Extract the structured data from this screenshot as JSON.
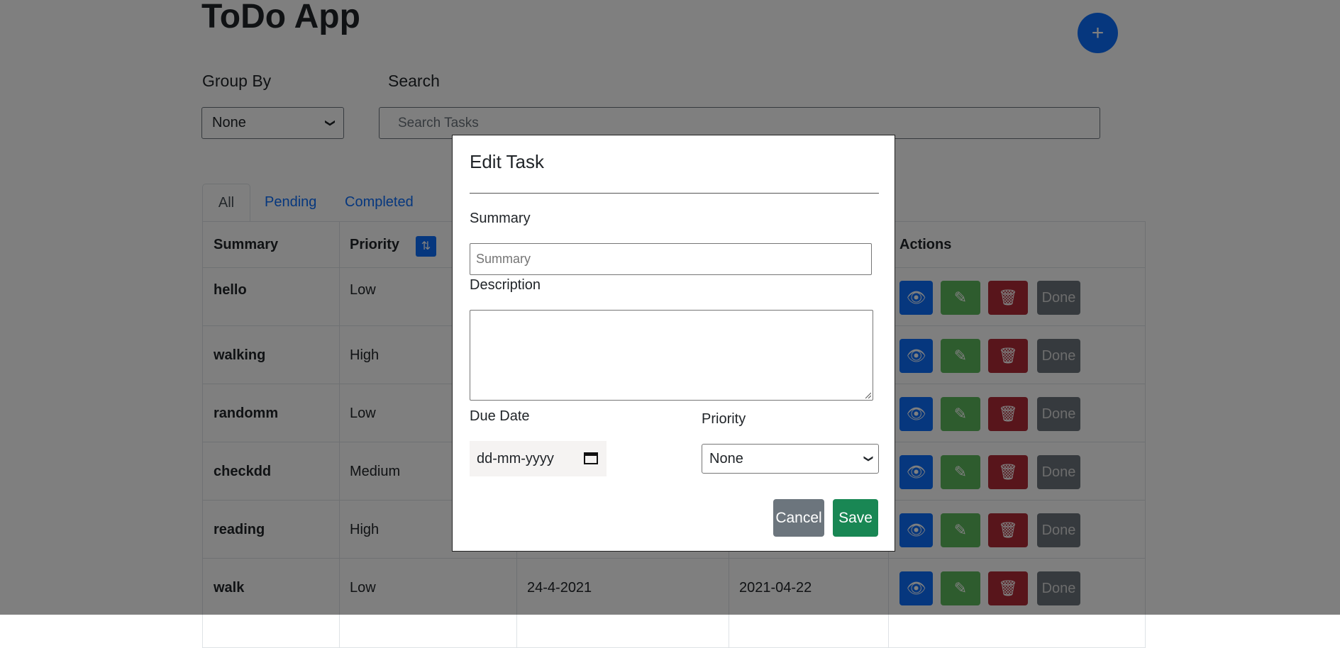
{
  "app": {
    "title": "ToDo App",
    "add_button_label": "+"
  },
  "filters": {
    "group_by_label": "Group By",
    "group_by_value": "None",
    "search_label": "Search",
    "search_placeholder": "Search Tasks"
  },
  "tabs": [
    {
      "label": "All",
      "active": true
    },
    {
      "label": "Pending",
      "active": false
    },
    {
      "label": "Completed",
      "active": false
    }
  ],
  "table": {
    "headers": {
      "summary": "Summary",
      "priority": "Priority",
      "actions": "Actions"
    },
    "rows": [
      {
        "summary": "hello",
        "priority": "Low",
        "created": "",
        "due": ""
      },
      {
        "summary": "walking",
        "priority": "High",
        "created": "",
        "due": ""
      },
      {
        "summary": "randomm",
        "priority": "Low",
        "created": "",
        "due": ""
      },
      {
        "summary": "checkdd",
        "priority": "Medium",
        "created": "",
        "due": ""
      },
      {
        "summary": "reading",
        "priority": "High",
        "created": "",
        "due": ""
      },
      {
        "summary": "walk",
        "priority": "Low",
        "created": "24-4-2021",
        "due": "2021-04-22"
      }
    ],
    "actions": {
      "done_label": "Done"
    }
  },
  "modal": {
    "title": "Edit Task",
    "summary_label": "Summary",
    "summary_placeholder": "Summary",
    "description_label": "Description",
    "due_date_label": "Due Date",
    "due_date_placeholder": "dd-mm-yyyy",
    "priority_label": "Priority",
    "priority_value": "None",
    "cancel_label": "Cancel",
    "save_label": "Save"
  },
  "colors": {
    "primary": "#0d6efd",
    "success": "#198754",
    "edit_green": "#5cb85c",
    "danger": "#b02a37",
    "secondary": "#6c757d"
  }
}
